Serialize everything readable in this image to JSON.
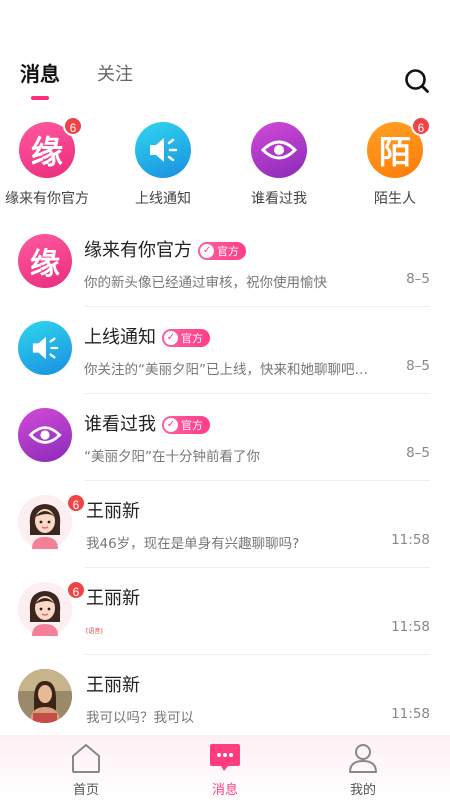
{
  "header": {
    "tabs": [
      {
        "label": "消息",
        "active": true
      },
      {
        "label": "关注",
        "active": false
      }
    ],
    "search_icon": "search-icon"
  },
  "quick_entries": [
    {
      "label": "缘来有你官方",
      "glyph": "缘",
      "badge": "6",
      "color": "#f0438a"
    },
    {
      "label": "上线通知",
      "icon": "speaker-icon",
      "color": "#1fb8ea"
    },
    {
      "label": "谁看过我",
      "icon": "eye-icon",
      "color": "#b63ccb"
    },
    {
      "label": "陌生人",
      "glyph": "陌",
      "badge": "6",
      "color": "#ff8a14"
    }
  ],
  "messages": [
    {
      "name": "缘来有你官方",
      "tag": "官方",
      "preview": "你的新头像已经通过审核，祝你使用愉快",
      "time": "8–5"
    },
    {
      "name": "上线通知",
      "tag": "官方",
      "preview": "你关注的“美丽夕阳”已上线，快来和她聊聊吧…",
      "time": "8–5"
    },
    {
      "name": "谁看过我",
      "tag": "官方",
      "preview": "“美丽夕阳”在十分钟前看了你",
      "time": "8–5"
    },
    {
      "name": "王丽新",
      "badge": "6",
      "preview": "我46岁，现在是单身有兴趣聊聊吗?",
      "time": "11:58"
    },
    {
      "name": "王丽新",
      "badge": "6",
      "preview": "",
      "note": "[语音]",
      "time": "11:58"
    },
    {
      "name": "王丽新",
      "preview": "我可以吗？我可以",
      "time": "11:58"
    }
  ],
  "bottom_nav": [
    {
      "label": "首页",
      "icon": "home-icon",
      "active": false
    },
    {
      "label": "消息",
      "icon": "message-icon",
      "active": true
    },
    {
      "label": "我的",
      "icon": "profile-icon",
      "active": false
    }
  ],
  "colors": {
    "accent": "#ff3d7f",
    "badge": "#f04345"
  }
}
